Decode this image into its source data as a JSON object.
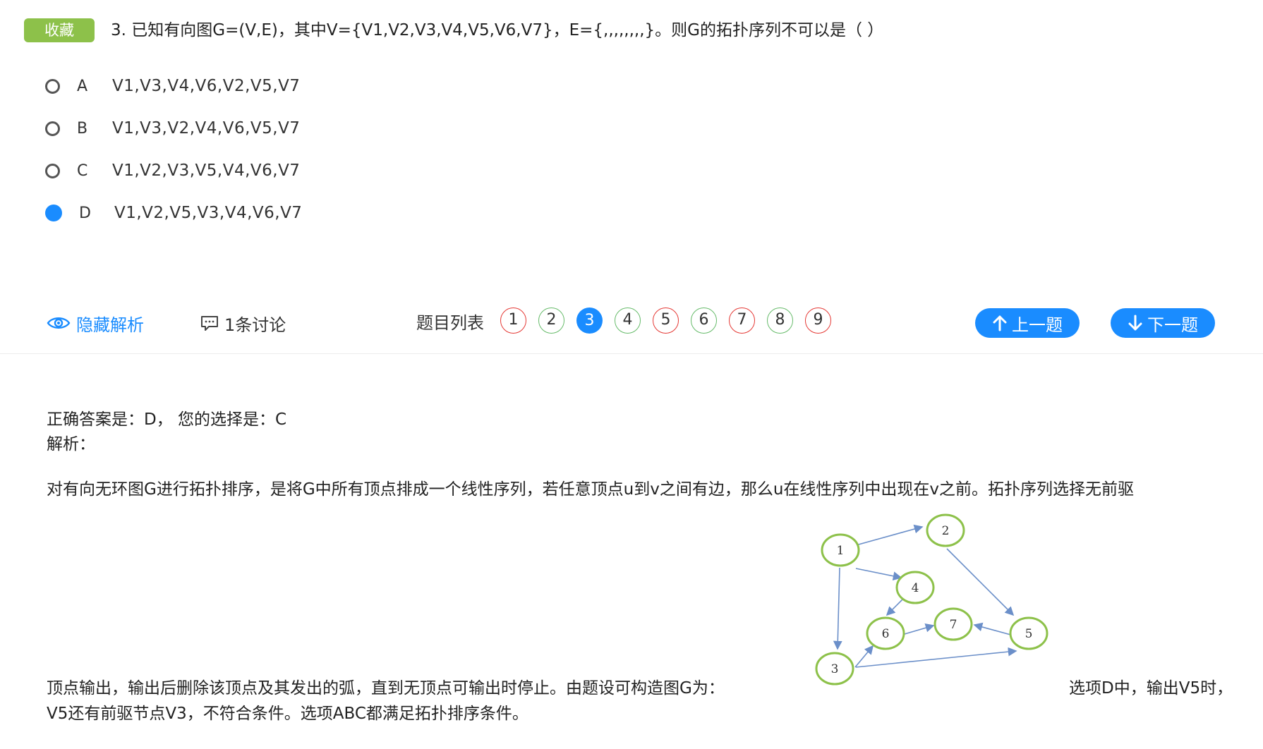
{
  "header": {
    "favorite_label": "收藏",
    "question_text": "3. 已知有向图G=(V,E)，其中V={V1,V2,V3,V4,V5,V6,V7}，E={,,,,,,,,}。则G的拓扑序列不可以是（ ）"
  },
  "options": [
    {
      "letter": "A",
      "text": "V1,V3,V4,V6,V2,V5,V7",
      "selected": false
    },
    {
      "letter": "B",
      "text": "V1,V3,V2,V4,V6,V5,V7",
      "selected": false
    },
    {
      "letter": "C",
      "text": "V1,V2,V3,V5,V4,V6,V7",
      "selected": false
    },
    {
      "letter": "D",
      "text": "V1,V2,V5,V3,V4,V6,V7",
      "selected": true
    }
  ],
  "toolbar": {
    "hide_analysis_label": "隐藏解析",
    "discussion_label": "1条讨论",
    "question_list_label": "题目列表",
    "question_numbers": [
      {
        "num": "1",
        "state": "wrong"
      },
      {
        "num": "2",
        "state": "correct"
      },
      {
        "num": "3",
        "state": "current"
      },
      {
        "num": "4",
        "state": "correct"
      },
      {
        "num": "5",
        "state": "wrong"
      },
      {
        "num": "6",
        "state": "correct"
      },
      {
        "num": "7",
        "state": "wrong"
      },
      {
        "num": "8",
        "state": "correct"
      },
      {
        "num": "9",
        "state": "wrong"
      }
    ],
    "prev_label": "上一题",
    "next_label": "下一题"
  },
  "analysis": {
    "answer_line": "正确答案是：D，  您的选择是：C",
    "analysis_label": "解析：",
    "para1": "对有向无环图G进行拓扑排序，是将G中所有顶点排成一个线性序列，若任意顶点u到v之间有边，那么u在线性序列中出现在v之前。拓扑序列选择无前驱",
    "para2_before": "顶点输出，输出后删除该顶点及其发出的弧，直到无顶点可输出时停止。由题设可构造图G为：",
    "para2_after": "选项D中，输出V5时，",
    "para3": "V5还有前驱节点V3，不符合条件。选项ABC都满足拓扑排序条件。"
  },
  "graph": {
    "nodes": [
      "1",
      "2",
      "3",
      "4",
      "5",
      "6",
      "7"
    ],
    "edges": [
      [
        "1",
        "2"
      ],
      [
        "1",
        "4"
      ],
      [
        "1",
        "3"
      ],
      [
        "2",
        "5"
      ],
      [
        "4",
        "6"
      ],
      [
        "3",
        "6"
      ],
      [
        "3",
        "5"
      ],
      [
        "6",
        "7"
      ],
      [
        "5",
        "7"
      ]
    ]
  },
  "colors": {
    "accent": "#1a8cff",
    "favorite_bg": "#8dc14a",
    "wrong": "#e53935",
    "correct": "#66bb6a",
    "node_stroke": "#8dc14a",
    "edge": "#6b8fc9"
  }
}
